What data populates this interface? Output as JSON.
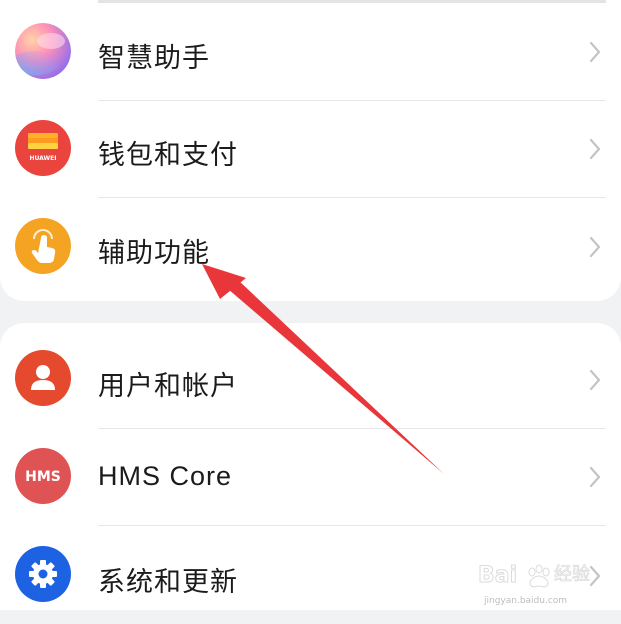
{
  "settings": {
    "group1": [
      {
        "label": "智慧助手",
        "icon": "celia-assistant-icon"
      },
      {
        "label": "钱包和支付",
        "icon": "huawei-wallet-icon",
        "icon_text": "HUAWEI"
      },
      {
        "label": "辅助功能",
        "icon": "accessibility-hand-icon"
      }
    ],
    "group2": [
      {
        "label": "用户和帐户",
        "icon": "user-account-icon"
      },
      {
        "label": "HMS Core",
        "icon": "hms-core-icon",
        "icon_text": "HMS"
      },
      {
        "label": "系统和更新",
        "icon": "system-gear-icon"
      }
    ]
  },
  "colors": {
    "accessibility": "#f5a323",
    "user": "#e54a2f",
    "hms": "#e05354",
    "system": "#1d62e3",
    "arrow": "#e8363a"
  },
  "watermark": {
    "brand": "Baidu 经验",
    "url": "jingyan.baidu.com"
  }
}
